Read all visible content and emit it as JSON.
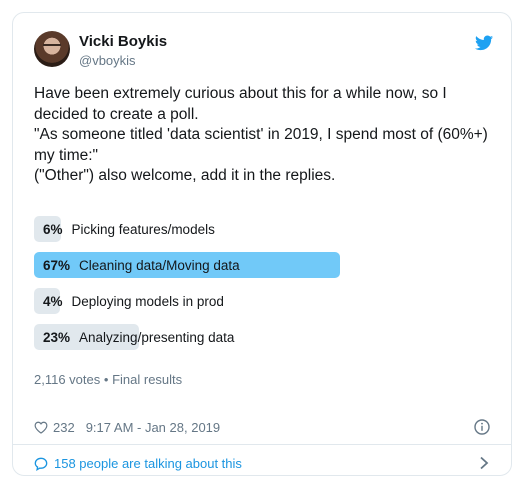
{
  "tweet": {
    "name": "Vicki Boykis",
    "handle": "@vboykis",
    "text": "Have been extremely curious about this for a while now, so I decided to create a poll.\n\"As someone titled 'data scientist' in 2019, I spend most of (60%+)  my time:\"\n(\"Other\") also welcome, add it in the replies.",
    "icons": {
      "brand": "twitter-bird-icon",
      "like": "heart-icon",
      "info": "info-icon",
      "reply": "speech-bubble-icon",
      "more": "chevron-right-icon"
    },
    "colors": {
      "accent": "#1da1f2",
      "winner_bar": "#71c9f8",
      "bar": "#e1e8ed",
      "link": "#1b95e0",
      "muted": "#657786"
    }
  },
  "poll": {
    "options": [
      {
        "percent_label": "6%",
        "percent": 6,
        "label": "Picking features/models",
        "winner": false
      },
      {
        "percent_label": "67%",
        "percent": 67,
        "label": "Cleaning data/Moving data",
        "winner": true
      },
      {
        "percent_label": "4%",
        "percent": 4,
        "label": "Deploying models in prod",
        "winner": false
      },
      {
        "percent_label": "23%",
        "percent": 23,
        "label": "Analyzing/presenting data",
        "winner": false
      }
    ],
    "votes": "2,116 votes",
    "separator": "•",
    "status": "Final results"
  },
  "footer": {
    "likes": "232",
    "timestamp": "9:17 AM - Jan 28, 2019",
    "talking": "158 people are talking about this"
  }
}
